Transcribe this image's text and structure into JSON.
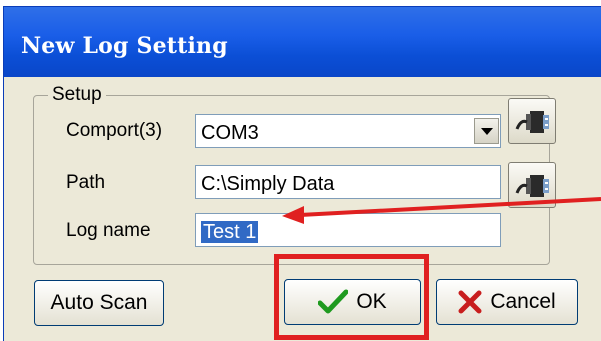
{
  "window": {
    "title": "New Log Setting"
  },
  "setup": {
    "legend": "Setup",
    "comport_label": "Comport(3)",
    "comport_value": "COM3",
    "path_label": "Path",
    "path_value": "C:\\Simply Data",
    "logname_label": "Log name",
    "logname_value": "Test 1"
  },
  "buttons": {
    "auto_scan": "Auto Scan",
    "ok": "OK",
    "cancel": "Cancel"
  },
  "annotation": {
    "color": "#e02020"
  },
  "icons": [
    "usb-plug-icon",
    "usb-plug-icon",
    "checkmark-icon",
    "x-icon",
    "chevron-down-icon"
  ]
}
